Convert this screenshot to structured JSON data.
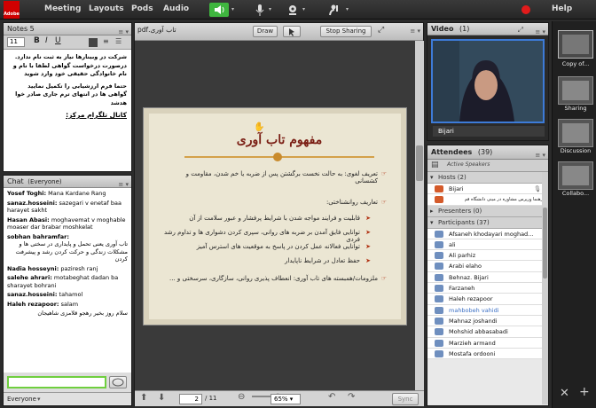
{
  "topbar": {
    "logo": "Adobe",
    "menus": [
      "Meeting",
      "Layouts",
      "Pods",
      "Audio"
    ],
    "help": "Help"
  },
  "notes": {
    "title": "Notes 5",
    "font_size": "11",
    "lines": [
      "شرکت در وبینارها نیاز به ثبت نام ندارد.",
      "درصورت درخواست گواهی لطفا با نام و نام خانوادگی حقیقی خود وارد شوید",
      "حتما فرم ارزشیابی را تکمیل نمایید گواهی ها در انتهای ترم جاری صادر خوا هدشد",
      "کانال تلگرام مرکز:"
    ]
  },
  "chat": {
    "title": "Chat",
    "scope": "(Everyone)",
    "footer": "Everyone",
    "messages": [
      {
        "name": "Yosef Toghi:",
        "text": "Mana Kardane Rang"
      },
      {
        "name": "sanaz.hosseini:",
        "text": "sazegari v enetaf baa harayet sakht"
      },
      {
        "name": "Hasan Abasi:",
        "text": "moghavemat v moghable moaser dar brabar moshkelat"
      },
      {
        "name": "sobhan bahramfar:",
        "text": "تاب آوری یعنی تحمل و پایداری در سختی ها و مشکلات زندگی و حرکت کردن رشد و پیشرفت کردن"
      },
      {
        "name": "Nadia hosseyni:",
        "text": "paziresh ranj"
      },
      {
        "name": "salehe ahrari:",
        "text": "motabeghat dadan ba sharayet bohrani"
      },
      {
        "name": "sanaz.hosseini:",
        "text": "tahamol"
      },
      {
        "name": "Haleh rezapoor:",
        "text": "salam"
      },
      {
        "name": "",
        "text": "سلام روز بخیر رهجو قلامزی شاهیجان"
      }
    ]
  },
  "share": {
    "filename": "تاب آوری.pdf",
    "draw": "Draw",
    "stop": "Stop Sharing",
    "page": "2",
    "total": "/ 11",
    "zoom": "65%",
    "sync": "Sync"
  },
  "slide": {
    "title": "مفهوم تاب آوری",
    "lines": [
      "تعریف لغوی: به حالت نخست برگشتن پس از ضربه یا خم شدن، مقاومت و کشسانی",
      "تعاریف روانشناختی:",
      "قابلیت و فرایند مواجه شدن با شرایط پرفشار و عبور سلامت از آن",
      "توانایی فایق آمدن بر ضربه های روانی، سپری کردن دشواری ها و تداوم رشد فردی",
      "توانایی فعالانه عمل کردن در پاسخ به موقعیت های استرس آمیز",
      "حفظ تعادل در شرایط ناپایدار",
      "ملزومات/همبسته های تاب آوری: انعطاف پذیری روانی، سازگاری، سرسختی و ..."
    ]
  },
  "video": {
    "title": "Video",
    "count": "(1)",
    "name": "Bijari"
  },
  "attendees": {
    "title": "Attendees",
    "count": "(39)",
    "active": "Active Speakers",
    "hosts_label": "Hosts (2)",
    "hosts": [
      "Bijari",
      "رهنما ورپرس مشاوره در مینی دانشگاه قم"
    ],
    "presenters_label": "Presenters (0)",
    "participants_label": "Participants (37)",
    "participants": [
      "Afsaneh khodayari moghad...",
      "ali",
      "Ali parhiz",
      "Arabi elaho",
      "Behnaz. Bijari",
      "Farzaneh",
      "Haleh rezapoor",
      "mahbobeh vahidi",
      "Mahnaz joshandi",
      "Mohshid abbasabadi",
      "Marzieh armand",
      "Mostafa ordooni"
    ]
  },
  "pods": [
    {
      "label": "Copy of..."
    },
    {
      "label": "Sharing"
    },
    {
      "label": "Discussion"
    },
    {
      "label": "Collabo..."
    }
  ],
  "colors": {
    "accent": "#d10000",
    "mic_green": "#3fb63f",
    "slide_title": "#7a1e14"
  }
}
